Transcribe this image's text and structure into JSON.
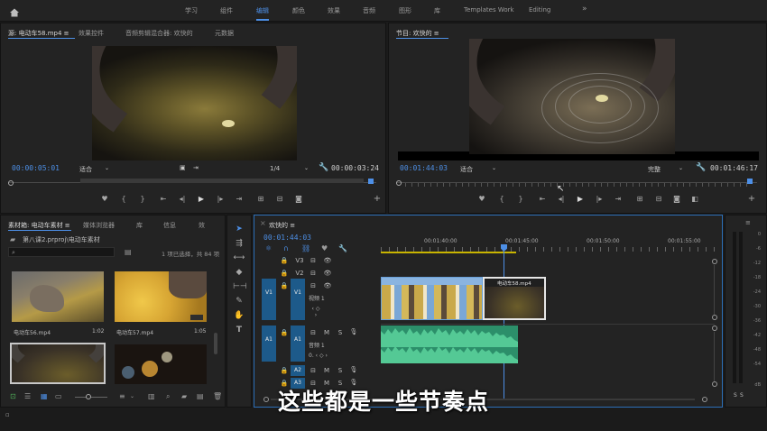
{
  "topbar": {
    "items": [
      "学习",
      "组件",
      "编辑",
      "颜色",
      "效果",
      "音频",
      "图形",
      "库",
      "Templates Work",
      "Editing",
      "»"
    ],
    "active_index": 2
  },
  "source_monitor": {
    "tabs": [
      "源: 电动车58.mp4 ≡",
      "效果控件",
      "音频剪辑混合器: 欢快的",
      "元数据"
    ],
    "timecode_left": "00:00:05:01",
    "fit": "适合",
    "resolution": "1/4",
    "timecode_right": "00:00:03:24"
  },
  "program_monitor": {
    "tab": "节目: 欢快的 ≡",
    "timecode_left": "00:01:44:03",
    "fit": "适合",
    "quality": "完整",
    "timecode_right": "00:01:46:17"
  },
  "project": {
    "tabs": [
      "素材箱: 电动车素材 ≡",
      "媒体浏览器",
      "库",
      "信息",
      "效"
    ],
    "path": "第八课2.prproj\\电动车素材",
    "selection_info": "1 项已选择，共 84 项",
    "items": [
      {
        "name": "电动车56.mp4",
        "duration": "1:02"
      },
      {
        "name": "电动车57.mp4",
        "duration": "1:05"
      },
      {
        "name": "",
        "duration": ""
      },
      {
        "name": "",
        "duration": ""
      }
    ]
  },
  "timeline": {
    "tab": "欢快的 ≡",
    "timecode": "00:01:44:03",
    "ruler_labels": [
      "00:01:40:00",
      "00:01:45:00",
      "00:01:50:00",
      "00:01:55:00"
    ],
    "tracks": {
      "v3": "V3",
      "v2": "V2",
      "v1_src": "V1",
      "v1": "V1",
      "v1_name": "视频 1",
      "a1_src": "A1",
      "a1": "A1",
      "a1_name": "音频 1",
      "a2": "A2",
      "a3": "A3"
    },
    "clip_label": "电动车58.mp4"
  },
  "meter": {
    "labels": [
      "0",
      "-6",
      "-12",
      "-18",
      "-24",
      "-30",
      "-36",
      "-42",
      "-48",
      "-54",
      "dB"
    ],
    "solo": [
      "S",
      "S"
    ]
  },
  "subtitle": "这些都是一些节奏点",
  "colors": {
    "accent": "#4d8fe6",
    "panel": "#232323",
    "audio_clip": "#2c8f6a",
    "video_clip": "#7aa7d6",
    "track_target": "#1d5a8a"
  }
}
